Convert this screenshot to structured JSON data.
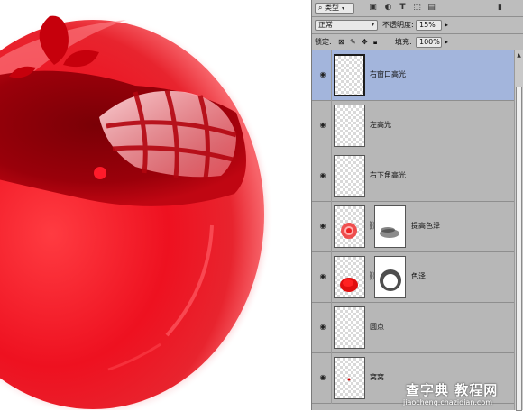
{
  "colors": {
    "panel_bg": "#b7b7b7",
    "selected_layer": "#a3b5dc",
    "apple_red": "#e3081a"
  },
  "toolbar1": {
    "filter_kind": "类型",
    "icons": [
      "search-icon",
      "image-filter-icon",
      "circle-filter-icon",
      "type-filter-icon",
      "shape-filter-icon",
      "smart-object-filter-icon",
      "filter-toggle-icon"
    ]
  },
  "toolbar2": {
    "blend_mode": "正常",
    "opacity_label": "不透明度:",
    "opacity_value": "15%"
  },
  "toolbar3": {
    "lock_label": "锁定:",
    "fill_label": "填充:",
    "fill_value": "100%"
  },
  "layers": [
    {
      "name": "右窗口高光",
      "selected": true,
      "has_mask": false
    },
    {
      "name": "左高光",
      "selected": false,
      "has_mask": false
    },
    {
      "name": "右下角高光",
      "selected": false,
      "has_mask": false
    },
    {
      "name": "提高色泽",
      "selected": false,
      "has_mask": true
    },
    {
      "name": "色泽",
      "selected": false,
      "has_mask": true
    },
    {
      "name": "圆点",
      "selected": false,
      "has_mask": false
    },
    {
      "name": "窝窝",
      "selected": false,
      "has_mask": false
    }
  ],
  "watermark": {
    "title": "查字典 教程网",
    "url": "jiaocheng.chazidian.com"
  }
}
